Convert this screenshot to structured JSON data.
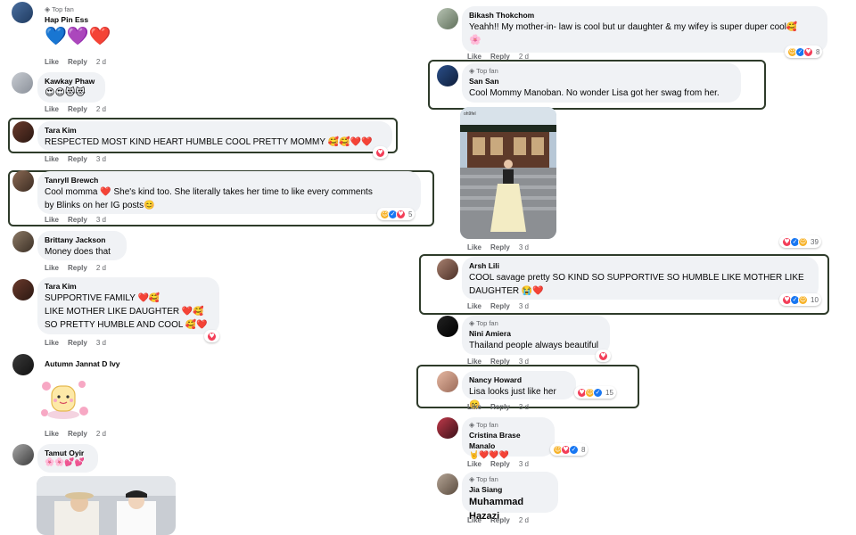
{
  "left": {
    "comments": [
      {
        "badge": "Top fan",
        "name": "Hap Pin Ess",
        "text": "",
        "emoji": "💙💜❤️",
        "like": "Like",
        "reply": "Reply",
        "time": "2 d"
      },
      {
        "name": "Kawkay Phaw",
        "emoji": "😍😍😻😻",
        "like": "Like",
        "reply": "Reply",
        "time": "2 d"
      },
      {
        "name": "Tara Kim",
        "text": "RESPECTED MOST KIND HEART HUMBLE COOL PRETTY MOMMY 🥰🥰❤️❤️",
        "like": "Like",
        "reply": "Reply",
        "time": "3 d"
      },
      {
        "name": "Tanryll Brewch",
        "text1": "Cool momma ❤️ She's kind too. She literally takes her time to like every comments",
        "text2": "by Blinks on her IG posts😊",
        "like": "Like",
        "reply": "Reply",
        "time": "3 d",
        "reactions": "5"
      },
      {
        "name": "Brittany Jackson",
        "text": "Money does that",
        "like": "Like",
        "reply": "Reply",
        "time": "2 d"
      },
      {
        "name": "Tara Kim",
        "text1": "SUPPORTIVE FAMILY ❤️🥰",
        "text2": "LIKE MOTHER LIKE DAUGHTER ❤️🥰",
        "text3": "SO PRETTY HUMBLE AND COOL 🥰❤️",
        "like": "Like",
        "reply": "Reply",
        "time": "3 d"
      },
      {
        "name": "Autumn Jannat D Ivy",
        "like": "Like",
        "reply": "Reply",
        "time": "2 d"
      },
      {
        "name": "Tamut Oyir",
        "emoji": "🌸🌸💕💕"
      }
    ]
  },
  "right": {
    "comments": [
      {
        "name": "Bikash Thokchom",
        "text": "Yeahh!! My mother-in- law is cool but ur daughter & my wifey is super duper cool🥰",
        "text2": "🌸",
        "like": "Like",
        "reply": "Reply",
        "time": "2 d",
        "reactions": "8"
      },
      {
        "badge": "Top fan",
        "name": "San San",
        "text": "Cool Mommy Manoban. No wonder Lisa got her swag from her."
      },
      {
        "photo_caption": "oh9fel",
        "like": "Like",
        "reply": "Reply",
        "time": "3 d",
        "reactions": "39"
      },
      {
        "name": "Arsh Lili",
        "text1": "COOL savage pretty SO KIND SO SUPPORTIVE SO HUMBLE LIKE MOTHER LIKE",
        "text2": "DAUGHTER 😭❤️",
        "like": "Like",
        "reply": "Reply",
        "time": "3 d",
        "reactions": "10"
      },
      {
        "badge": "Top fan",
        "name": "Nini Amiera",
        "text": "Thailand people always beautiful",
        "like": "Like",
        "reply": "Reply",
        "time": "3 d"
      },
      {
        "name": "Nancy Howard",
        "text": "Lisa looks just like her 😊",
        "like": "Like",
        "reply": "Reply",
        "time": "3 d",
        "reactions": "15"
      },
      {
        "badge": "Top fan",
        "name": "Cristina Brase Manalo",
        "emoji": "🤘❤️❤️❤️",
        "like": "Like",
        "reply": "Reply",
        "time": "3 d",
        "reactions": "8"
      },
      {
        "badge": "Top fan",
        "name": "Jia Siang",
        "text": "Muhammad Hazazi",
        "like": "Like",
        "reply": "Reply",
        "time": "2 d"
      }
    ]
  },
  "colors": {
    "bubble": "#f0f2f5",
    "meta": "#65676b",
    "highlight": "#2e3b2a",
    "heart": "#f33e58",
    "like": "#1877f2",
    "care": "#f7b125"
  },
  "icons": [
    "diamond-badge-icon",
    "heart-reaction-icon",
    "like-reaction-icon",
    "care-reaction-icon",
    "haha-reaction-icon"
  ]
}
